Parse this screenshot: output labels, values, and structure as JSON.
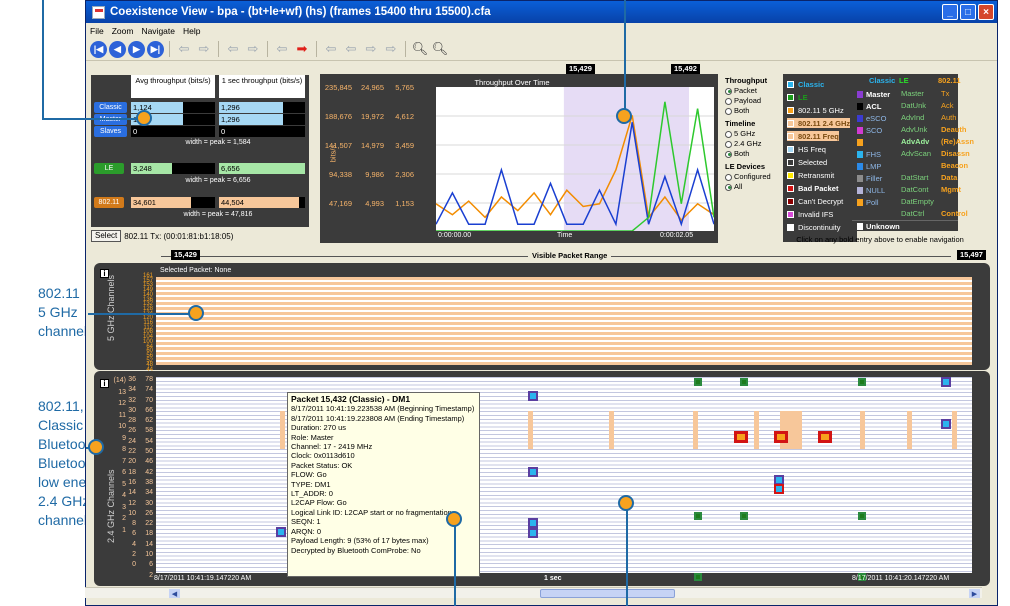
{
  "annotations": {
    "wifi5": "802.11\n5 GHz\nchannels",
    "wifi24": "802.11,\nClassic\nBluetooth,\nBluetooth\nlow energy\n2.4 GHz\nchannels"
  },
  "window": {
    "title": "Coexistence View - bpa - (bt+le+wf) (hs) (frames 15400 thru 15500).cfa"
  },
  "menu": [
    "File",
    "Zoom",
    "Navigate",
    "Help"
  ],
  "throughput_table": {
    "header_avg": "Avg throughput (bits/s)",
    "header_1sec": "1 sec throughput (bits/s)",
    "rows": [
      {
        "label": "Classic",
        "avg": "1,124",
        "sec": "1,296",
        "avg_fill": 0.62,
        "sec_fill": 0.74
      },
      {
        "label": "Master",
        "avg": "1,124",
        "sec": "1,296",
        "avg_fill": 0.62,
        "sec_fill": 0.74
      },
      {
        "label": "Slaves",
        "avg": "0",
        "sec": "0",
        "avg_fill": 0,
        "sec_fill": 0
      }
    ],
    "classic_width_note": "width = peak = 1,584",
    "le": {
      "label": "LE",
      "avg": "3,248",
      "sec": "6,656",
      "avg_fill": 0.49,
      "sec_fill": 1.0
    },
    "le_width_note": "width = peak = 6,656",
    "wifi": {
      "label": "802.11",
      "avg": "34,601",
      "sec": "44,504",
      "avg_fill": 0.72,
      "sec_fill": 0.93
    },
    "wifi_width_note": "width = peak = 47,816"
  },
  "select_button": "Select",
  "select_text": "802.11 Tx: (00:01:81:b1:18:05)",
  "chart_markers": {
    "left": "15,429",
    "right": "15,492"
  },
  "chart_data": {
    "type": "line",
    "title": "Throughput Over Time",
    "xlabel": "Time",
    "ylabel": "bits/s",
    "x_start_label": "0:00:00.00",
    "x_end_label": "0:00:02.05",
    "y_ticks_col1": [
      "235,845",
      "188,676",
      "141,507",
      "94,338",
      "47,169"
    ],
    "y_ticks_col2": [
      "24,965",
      "19,972",
      "14,979",
      "9,986",
      "4,993"
    ],
    "y_ticks_col3": [
      "5,765",
      "4,612",
      "3,459",
      "2,306",
      "1,153"
    ],
    "series": [
      {
        "color": "#f28c00",
        "values": [
          0.2,
          0.12,
          0.22,
          0.1,
          0.25,
          0.15,
          0.28,
          0.12,
          0.3,
          0.18,
          0.2,
          0.45,
          0.85,
          0.1,
          0.25,
          0.08,
          0.2,
          0.12
        ]
      },
      {
        "color": "#1a3fd1",
        "values": [
          0.05,
          0.28,
          0.05,
          0.05,
          0.45,
          0.05,
          0.05,
          0.35,
          0.05,
          0.05,
          0.3,
          0.05,
          0.8,
          0.05,
          0.4,
          0.05,
          0.45,
          0.05
        ]
      },
      {
        "color": "#2ec92e",
        "values": [
          0,
          0,
          0,
          0,
          0,
          0,
          0,
          0,
          0,
          0,
          0,
          0,
          0,
          0.1,
          0.95,
          0.2,
          0.9,
          0.1
        ]
      }
    ]
  },
  "options": {
    "throughput_heading": "Throughput",
    "throughput": [
      "Packet",
      "Payload",
      "Both"
    ],
    "timeline_heading": "Timeline",
    "timeline": [
      "5 GHz",
      "2.4 GHz",
      "Both"
    ],
    "le_heading": "LE Devices",
    "le_devices": [
      "Configured",
      "All"
    ]
  },
  "legend_left": [
    {
      "label": "Classic",
      "color": "#2bb4ee",
      "bold": true
    },
    {
      "label": "LE",
      "color": "#1c9c1c",
      "bold": true
    },
    {
      "label": "802.11 5 GHz",
      "color": "#f7a21e",
      "bold": false
    },
    {
      "label": "802.11 2.4 GHz",
      "color": "#f7c79a",
      "bold": true
    },
    {
      "label": "802.11 Freq",
      "color": "#f7c79a",
      "bold": true
    },
    {
      "label": "HS Freq",
      "color": "#a6d8f4",
      "bold": false
    },
    {
      "label": "Selected",
      "color": "#3b3b3b",
      "bold": false
    },
    {
      "label": "Retransmit",
      "color": "#ffea00",
      "bold": false
    },
    {
      "label": "Bad Packet",
      "color": "#d21414",
      "bold": true
    },
    {
      "label": "Can't Decrypt",
      "color": "#8b0000",
      "bold": false
    },
    {
      "label": "Invalid IFS",
      "color": "#d94cd9",
      "bold": false
    },
    {
      "label": "Discontinuity",
      "color": "#ffffff",
      "bold": false
    }
  ],
  "legend_right": {
    "headers": [
      "Classic",
      "LE",
      "802.11"
    ],
    "col1": [
      {
        "label": "Master",
        "color": "#8a3cd1",
        "bold": true
      },
      {
        "label": "ACL",
        "color": "#000000",
        "bold": true
      },
      {
        "label": "eSCO",
        "color": "#3b3bd1",
        "bold": false
      },
      {
        "label": "SCO",
        "color": "#d13bd1",
        "bold": false
      },
      {
        "label": "",
        "color": "#f7a21e",
        "bold": false
      },
      {
        "label": "FHS",
        "color": "#2bb4ee",
        "bold": false
      },
      {
        "label": "LMP",
        "color": "#2b8ae8",
        "bold": false
      },
      {
        "label": "Filler",
        "color": "#8c8c8c",
        "bold": false
      },
      {
        "label": "NULL",
        "color": "#b4b4d8",
        "bold": false
      },
      {
        "label": "Poll",
        "color": "#f7a21e",
        "bold": false
      }
    ],
    "col2": [
      "Master",
      "DatUnk",
      "AdvInd",
      "AdvUnk",
      "AdvAdv",
      "AdvScan",
      "",
      "DatStart",
      "DatCont",
      "DatEmpty",
      "DatCtrl"
    ],
    "col3": [
      "Tx",
      "Ack",
      "Auth",
      "Deauth",
      "(Re)Assn",
      "Disassn",
      "Beacon",
      "Data",
      "Mgmt",
      "",
      "Control"
    ],
    "unknown": "Unknown"
  },
  "hint": "Click on any bold entry above to enable navigation",
  "range": {
    "left": "15,429",
    "right": "15,497",
    "title": "Visible Packet Range"
  },
  "panel5": {
    "selected": "Selected Packet: None",
    "axis_label": "5 GHz Channels",
    "channels": [
      "161",
      "157",
      "153",
      "149",
      "140",
      "136",
      "132",
      "128",
      "124",
      "120",
      "116",
      "112",
      "108",
      "104",
      "100",
      "64",
      "60",
      "56",
      "52",
      "48",
      "44",
      "40",
      "36"
    ]
  },
  "panel24": {
    "axis_label": "2.4 GHz Channels",
    "wifi_ch": [
      "(14)",
      "13",
      "12",
      "11",
      "10",
      "9",
      "8",
      "7",
      "6",
      "5",
      "4",
      "3",
      "2",
      "1"
    ],
    "le_ch": [
      "39",
      "",
      "",
      "",
      "",
      "",
      "",
      "",
      "",
      "",
      "",
      "38",
      "",
      "",
      "",
      "",
      "",
      "37"
    ],
    "bt_ch": [
      "78",
      "74",
      "70",
      "66",
      "62",
      "58",
      "54",
      "50",
      "46",
      "42",
      "38",
      "34",
      "30",
      "26",
      "22",
      "18",
      "14",
      "10",
      "6",
      "2"
    ],
    "bt_ch2": [
      "36",
      "34",
      "32",
      "30",
      "28",
      "26",
      "24",
      "22",
      "20",
      "18",
      "16",
      "14",
      "12",
      "10",
      "8",
      "6",
      "4",
      "2",
      "0"
    ],
    "time_left": "8/17/2011 10:41:19.147220 AM",
    "time_mid": "1 sec",
    "time_right": "8/17/2011 10:41:20.147220 AM"
  },
  "tooltip": {
    "title": "Packet 15,432 (Classic) - DM1",
    "lines": [
      "8/17/2011 10:41:19.223538 AM (Beginning Timestamp)",
      "8/17/2011 10:41:19.223808 AM (Ending Timestamp)",
      "Duration: 270 us",
      "Role: Master",
      "Channel: 17 - 2419 MHz",
      "Clock: 0x0113d610",
      "Packet Status: OK",
      "FLOW: Go",
      "TYPE: DM1",
      "LT_ADDR: 0",
      "L2CAP Flow: Go",
      "Logical Link ID: L2CAP start or no fragmentation",
      "SEQN: 1",
      "ARQN: 0",
      "Payload Length: 9 (53% of 17 bytes max)",
      "Decrypted by Bluetooth ComProbe: No"
    ]
  }
}
